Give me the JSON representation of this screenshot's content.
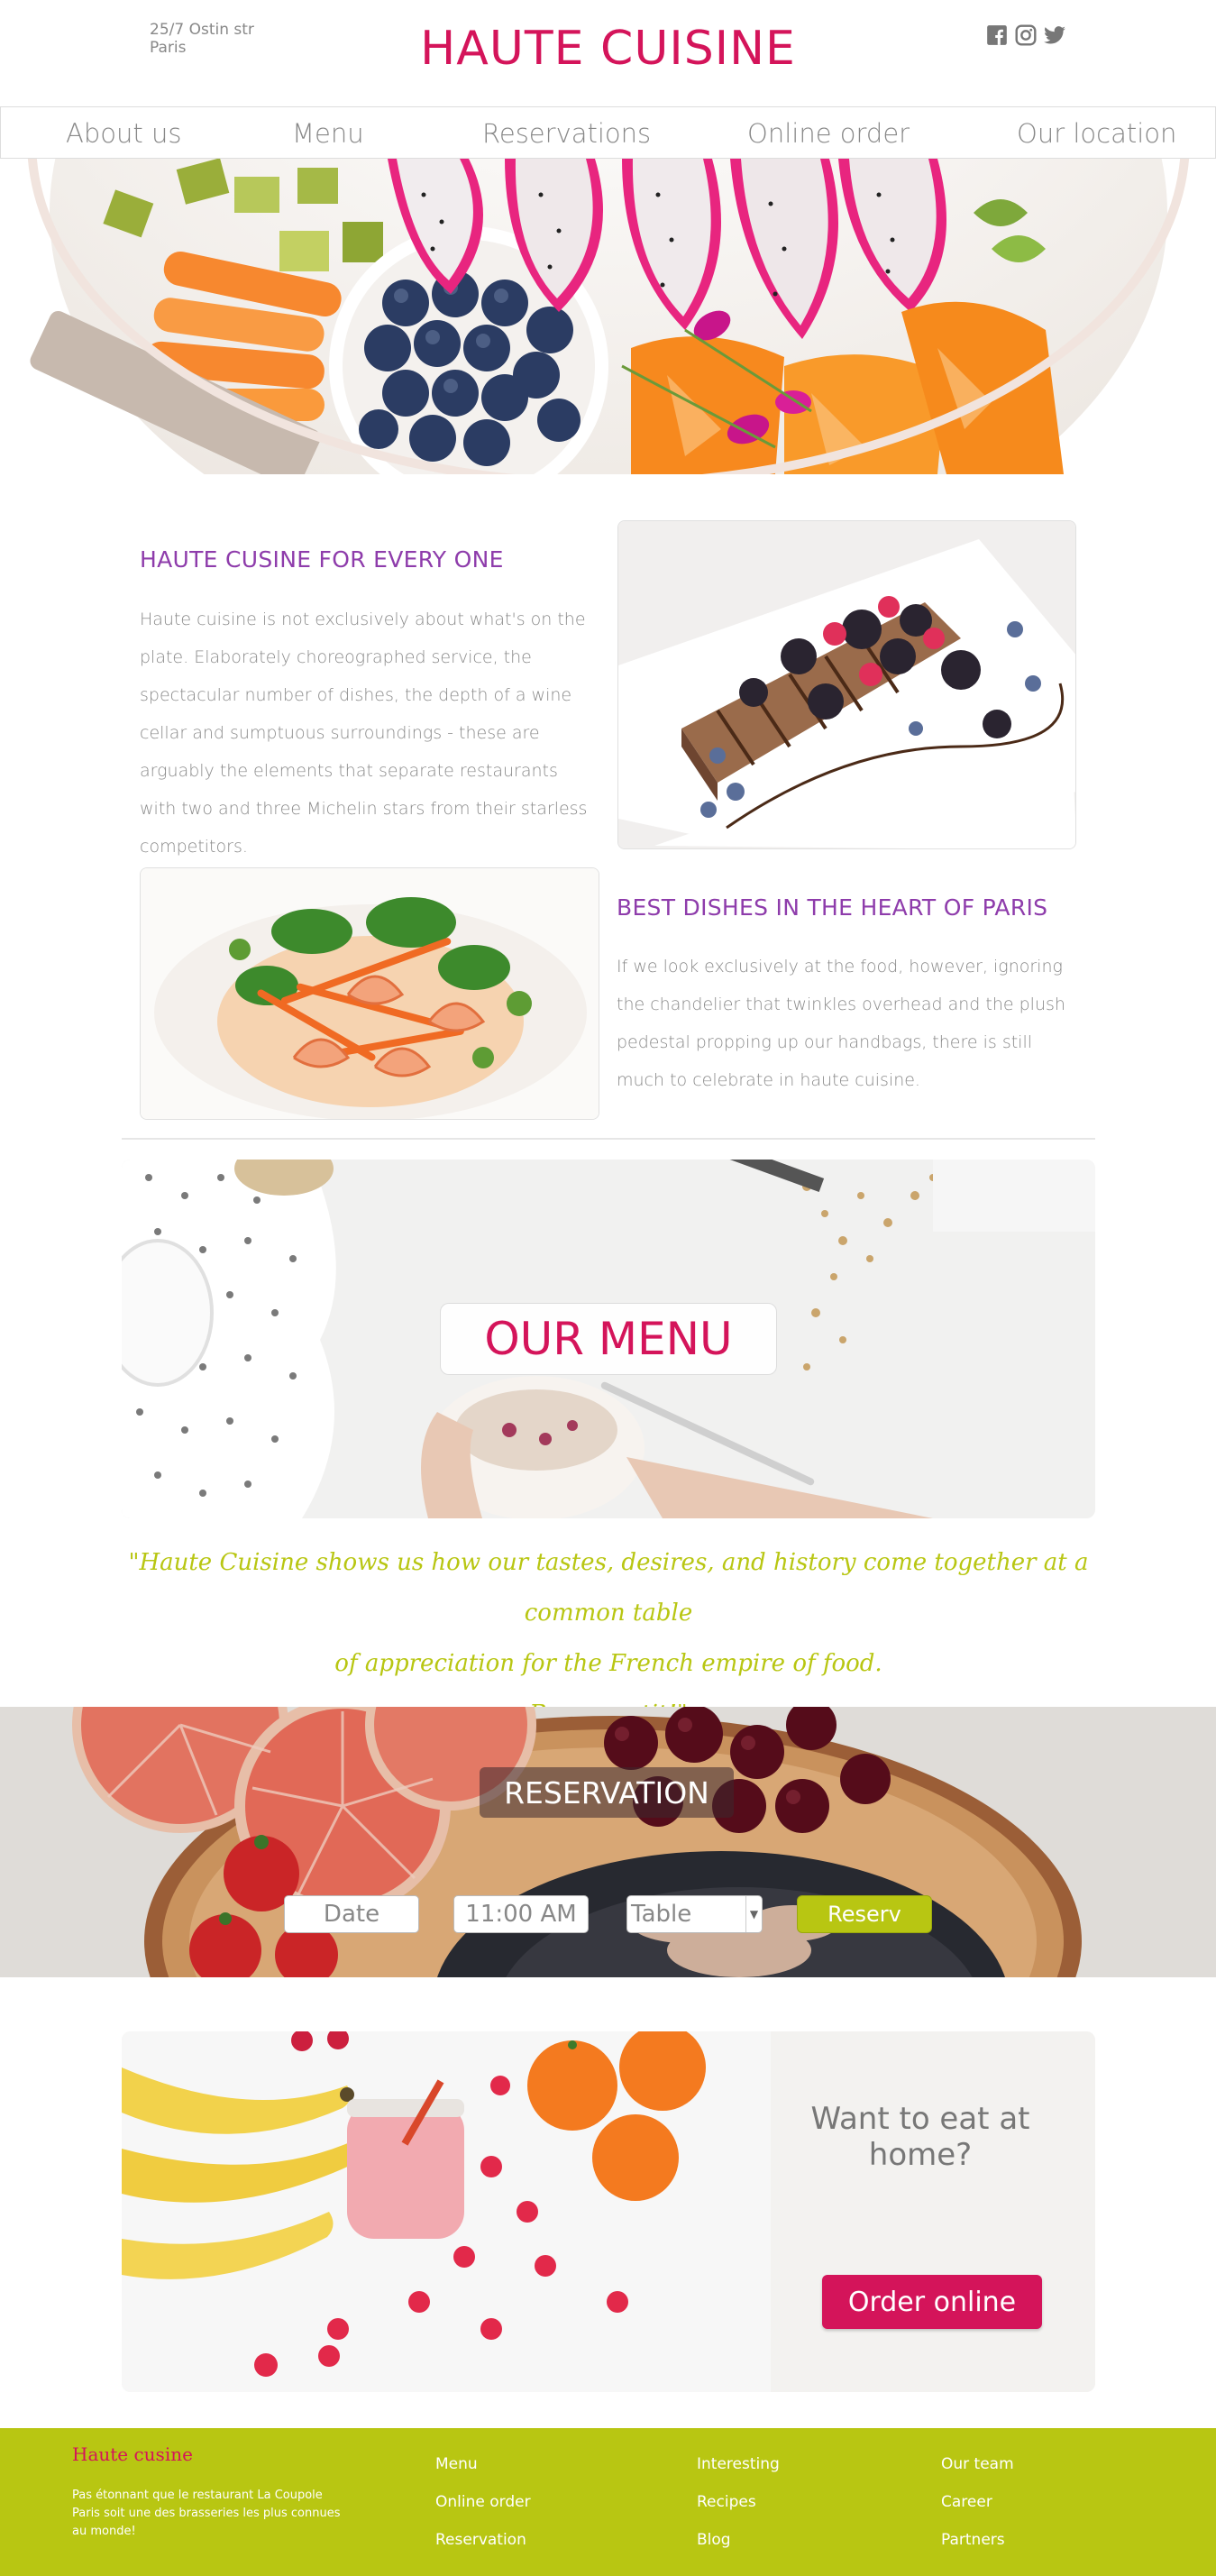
{
  "header": {
    "address_line1": "25/7 Ostin str",
    "address_line2": "Paris",
    "brand": "HAUTE CUISINE",
    "social_icons": [
      "facebook-icon",
      "instagram-icon",
      "twitter-icon"
    ]
  },
  "nav": {
    "items": [
      "About us",
      "Menu",
      "Reservations",
      "Online order",
      "Our location"
    ]
  },
  "section1": {
    "title": "HAUTE CUSINE FOR EVERY ONE",
    "text": "Haute cuisine is not exclusively about what's on the plate. Elaborately choreographed service, the spectacular number of dishes, the depth of a wine cellar and sumptuous surroundings - these are arguably the elements that separate restaurants with two and three Michelin stars from their starless competitors."
  },
  "section2": {
    "title": "BEST DISHES IN THE HEART OF PARIS",
    "text": "If we look exclusively at the food, however, ignoring the chandelier that twinkles overhead and the plush pedestal propping up our handbags, there is still much to celebrate in haute cuisine."
  },
  "menu_banner": {
    "label": "OUR MENU"
  },
  "quote": {
    "line1": "\"Haute Cuisine shows us how our tastes, desires, and history come together at a common table",
    "line2": "of appreciation for the French empire of food.",
    "line3": "Bon appetit!\""
  },
  "reservation": {
    "title": "RESERVATION",
    "date_placeholder": "Date",
    "time_value": "11:00 AM",
    "table_value": "Table",
    "button": "Reserv"
  },
  "home": {
    "title_line1": "Want to eat at",
    "title_line2": "home?",
    "button": "Order online"
  },
  "footer": {
    "title": "Haute cusine",
    "desc": "Pas étonnant que le restaurant La Coupole Paris soit une des brasseries les plus connues au monde!",
    "col1": [
      "Menu",
      "Online order",
      "Reservation"
    ],
    "col2": [
      "Interesting",
      "Recipes",
      "Blog"
    ],
    "col3": [
      "Our team",
      "Career",
      "Partners"
    ]
  },
  "colors": {
    "brand_pink": "#d4145a",
    "heading_purple": "#8e3cab",
    "accent_lime": "#b8c612"
  }
}
